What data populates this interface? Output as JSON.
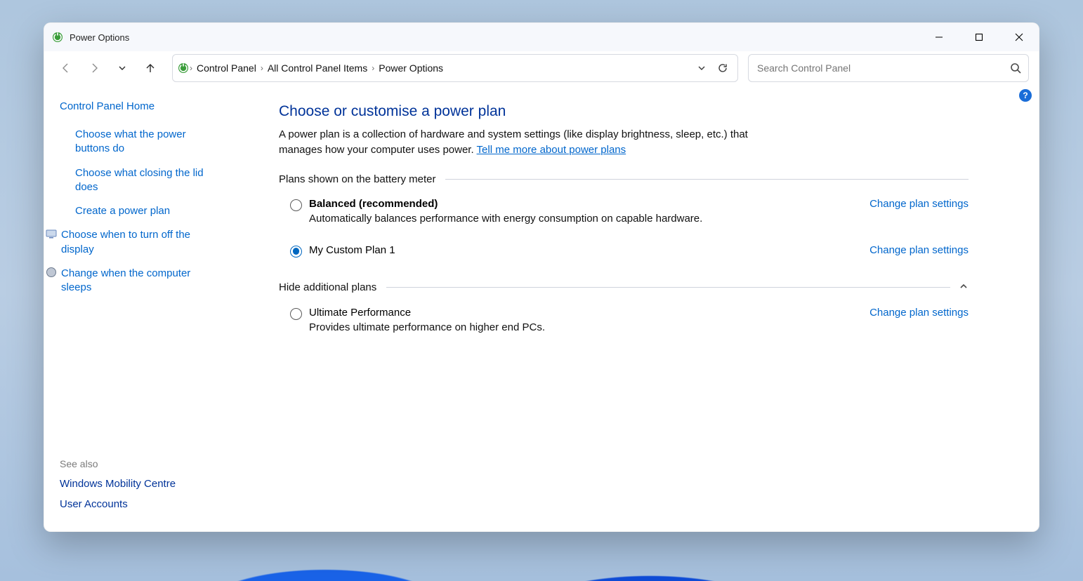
{
  "window": {
    "title": "Power Options"
  },
  "breadcrumbs": [
    "Control Panel",
    "All Control Panel Items",
    "Power Options"
  ],
  "search": {
    "placeholder": "Search Control Panel"
  },
  "sidebar": {
    "home": "Control Panel Home",
    "links": [
      {
        "label": "Choose what the power buttons do",
        "icon": false
      },
      {
        "label": "Choose what closing the lid does",
        "icon": false
      },
      {
        "label": "Create a power plan",
        "icon": false
      },
      {
        "label": "Choose when to turn off the display",
        "icon": true
      },
      {
        "label": "Change when the computer sleeps",
        "icon": true
      }
    ],
    "see_also_label": "See also",
    "see_also": [
      "Windows Mobility Centre",
      "User Accounts"
    ]
  },
  "main": {
    "heading": "Choose or customise a power plan",
    "desc_pre": "A power plan is a collection of hardware and system settings (like display brightness, sleep, etc.) that manages how your computer uses power. ",
    "desc_link": "Tell me more about power plans",
    "section1_label": "Plans shown on the battery meter",
    "section2_label": "Hide additional plans",
    "change_label": "Change plan settings",
    "plans_primary": [
      {
        "name": "Balanced (recommended)",
        "desc": "Automatically balances performance with energy consumption on capable hardware.",
        "selected": false,
        "bold": true
      },
      {
        "name": "My Custom Plan 1",
        "desc": "",
        "selected": true,
        "bold": false
      }
    ],
    "plans_additional": [
      {
        "name": "Ultimate Performance",
        "desc": "Provides ultimate performance on higher end PCs.",
        "selected": false,
        "bold": false
      }
    ]
  },
  "help_badge": "?"
}
